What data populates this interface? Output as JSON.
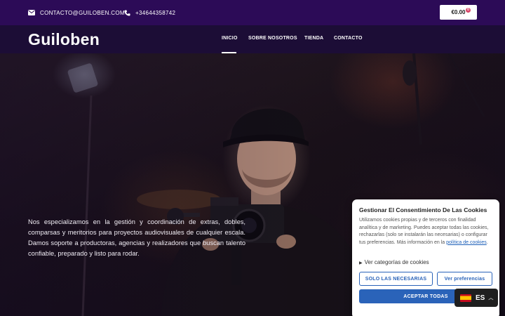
{
  "topbar": {
    "email": "CONTACTO@GUILOBEN.COM",
    "phone": "+34644358742",
    "cart_total": "€0.00",
    "cart_count": "0"
  },
  "header": {
    "logo": "Guiloben",
    "nav": [
      {
        "label": "INICIO",
        "active": true
      },
      {
        "label": "SOBRE NOSOTROS",
        "active": false
      },
      {
        "label": "TIENDA",
        "active": false
      },
      {
        "label": "CONTACTO",
        "active": false
      }
    ]
  },
  "hero": {
    "text_line1": "Nos especializamos en la gestión y coordinación de extras, dobles, comparsas y meritorios para proyectos audiovisuales de cualquier escala. Damos soporte a productoras, agencias y realizadores que buscan talento confiable, preparado y listo para rodar."
  },
  "cookie": {
    "title": "Gestionar El Consentimiento De Las Cookies",
    "text": "Utilizamos cookies propias y de terceros con finalidad analítica y de marketing. Puedes aceptar todas las cookies, rechazarlas (solo se instalarán las necesarias) o configurar tus preferencias. Más información en la",
    "link_label": "política de cookies",
    "link_suffix": ".",
    "categories_label": "Ver categorías de cookies",
    "btn_necessary": "SOLO LAS NECESARIAS",
    "btn_preferences": "Ver preferencias",
    "btn_accept": "ACEPTAR TODAS"
  },
  "language": {
    "code": "ES"
  },
  "colors": {
    "topbar": "#2c0b57",
    "navbar": "#1c0d36",
    "accent_blue": "#2a63b9"
  },
  "icons": {
    "email": "envelope-icon",
    "phone": "phone-icon",
    "language_flag": "spain-flag-icon",
    "chevron": "chevron-up-icon",
    "disclosure": "triangle-right-icon"
  }
}
